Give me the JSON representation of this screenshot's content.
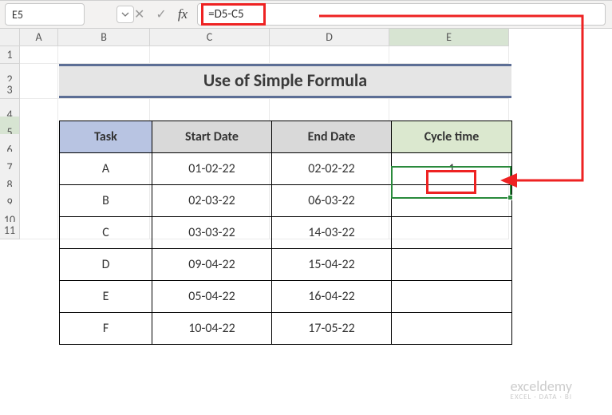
{
  "domain": "Computer-Use",
  "formula_bar": {
    "cell_ref": "E5",
    "formula": "=D5-C5",
    "fx_label": "fx",
    "cancel_icon": "✕",
    "accept_icon": "✓"
  },
  "columns": [
    "A",
    "B",
    "C",
    "D",
    "E"
  ],
  "rows": [
    "1",
    "2",
    "3",
    "4",
    "5",
    "6",
    "7",
    "8",
    "9",
    "10",
    "11"
  ],
  "selected_column": "E",
  "selected_row": "5",
  "title": "Use of Simple Formula",
  "headers": {
    "task": "Task",
    "start": "Start Date",
    "end": "End Date",
    "cycle": "Cycle time"
  },
  "table": [
    {
      "task": "A",
      "start": "01-02-22",
      "end": "02-02-22",
      "cycle": "1"
    },
    {
      "task": "B",
      "start": "02-03-22",
      "end": "06-03-22",
      "cycle": ""
    },
    {
      "task": "C",
      "start": "03-03-22",
      "end": "14-03-22",
      "cycle": ""
    },
    {
      "task": "D",
      "start": "09-04-22",
      "end": "15-04-22",
      "cycle": ""
    },
    {
      "task": "E",
      "start": "05-04-22",
      "end": "16-04-22",
      "cycle": ""
    },
    {
      "task": "F",
      "start": "10-04-22",
      "end": "17-05-22",
      "cycle": ""
    }
  ],
  "watermark": {
    "brand": "exceldemy",
    "tagline": "EXCEL · DATA · BI"
  }
}
